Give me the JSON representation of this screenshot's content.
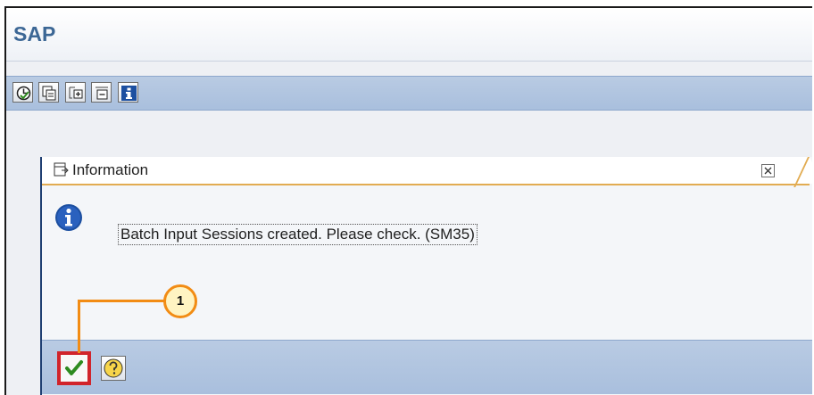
{
  "app": {
    "title": "SAP"
  },
  "toolbar": {
    "buttons": [
      {
        "name": "execute-clock-icon"
      },
      {
        "name": "copy-icon"
      },
      {
        "name": "expand-node-icon"
      },
      {
        "name": "collapse-node-icon"
      },
      {
        "name": "information-icon"
      }
    ]
  },
  "dialog": {
    "title": "Information",
    "message": "Batch Input Sessions created. Please check. (SM35)",
    "icons": {
      "info": "info-icon",
      "close": "close-icon",
      "ok": "checkmark-icon",
      "help": "help-icon"
    }
  },
  "callout": {
    "number": "1"
  },
  "colors": {
    "sap_title": "#3c6795",
    "toolbar_blue": "#b9cbe3",
    "dialog_border_accent": "#e2ac52",
    "highlight_red": "#d1242b",
    "callout_orange": "#f28c14",
    "callout_fill": "#fff4c2",
    "ok_green": "#2e8b1f",
    "info_blue": "#1c4fa0"
  }
}
